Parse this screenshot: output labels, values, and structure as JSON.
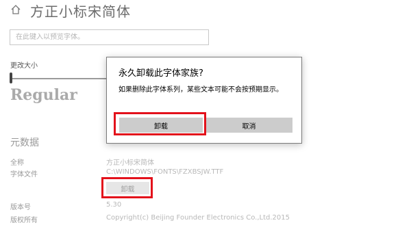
{
  "header": {
    "icon": "home-icon",
    "title": "方正小标宋简体"
  },
  "preview": {
    "placeholder": "在此键入以预览字体。"
  },
  "size": {
    "label": "更改大小",
    "slider_fraction": 0.0
  },
  "sample_text": "Regular",
  "metadata": {
    "title": "元数据",
    "fullname_label": "全称",
    "fullname_value": "方正小标宋简体",
    "file_label": "字体文件",
    "file_value": "C:\\WINDOWS\\FONTS\\FZXBSJW.TTF",
    "uninstall_label": "卸载",
    "version_label": "版本号",
    "version_value": "5.30",
    "copyright_label": "版权所有",
    "copyright_value": "Copyright(c) Beijing Founder Electronics Co.,Ltd.2015"
  },
  "dialog": {
    "title": "永久卸载此字体家族?",
    "message": "如果删除此字体系列，某些文本可能不会按预期显示。",
    "uninstall_label": "卸载",
    "cancel_label": "取消"
  },
  "colors": {
    "highlight": "#e3111b"
  }
}
